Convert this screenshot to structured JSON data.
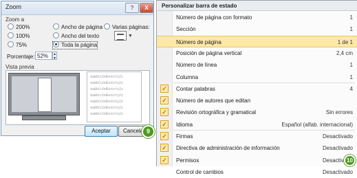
{
  "zoom_dialog": {
    "title": "Zoom",
    "help_icon": "?",
    "close_icon": "X",
    "group_label": "Zoom a",
    "options": {
      "p200": "200%",
      "p100": "100%",
      "p75": "75%",
      "page_width": "Ancho de página",
      "text_width": "Ancho del texto",
      "whole_page": "Toda la página",
      "many_pages": "Varias páginas:"
    },
    "percent_label": "Porcentaje:",
    "percent_value": "52%",
    "preview_label": "Vista previa",
    "sample_text": [
      "AaBbCcDdEeXxYyZz",
      "AaBbCcDdEeXxYyZz",
      "AaBbCcDdEeXxYyZz",
      "AaBbCcDdEeXxYyZz",
      "AaBbCcDdEeXxYyZz",
      "AaBbCcDdEeXxYyZz",
      "AaBbCcDdEeXxYyZz"
    ],
    "ok_label": "Aceptar",
    "cancel_label": "Cancelar",
    "badge": "9"
  },
  "status_menu": {
    "title": "Personalizar barra de estado",
    "badge": "10",
    "check_mark": "✓",
    "items": [
      {
        "label": "Número de página con formato",
        "value": "1",
        "checked": false
      },
      {
        "label": "Sección",
        "value": "1",
        "checked": false
      },
      {
        "label": "Número de página",
        "value": "1 de 1",
        "checked": false,
        "highlighted": true
      },
      {
        "label": "Posición de página vertical",
        "value": "2,4 cm",
        "checked": false
      },
      {
        "label": "Número de línea",
        "value": "1",
        "checked": false
      },
      {
        "label": "Columna",
        "value": "1",
        "checked": false
      },
      {
        "label": "Contar palabras",
        "value": "4",
        "checked": true
      },
      {
        "label": "Número de autores que editan",
        "value": "",
        "checked": true
      },
      {
        "label": "Revisión ortográfica y gramatical",
        "value": "Sin errores",
        "checked": true
      },
      {
        "label": "Idioma",
        "value": "Español (alfab. internacional)",
        "checked": true
      },
      {
        "label": "Firmas",
        "value": "Desactivado",
        "checked": true
      },
      {
        "label": "Directiva de administración de información",
        "value": "Desactivado",
        "checked": true
      },
      {
        "label": "Permisos",
        "value": "Desactivado",
        "checked": true
      },
      {
        "label": "Control de cambios",
        "value": "Desactivado",
        "checked": false
      }
    ]
  },
  "colors": {
    "highlight": "#fce9a8",
    "check_bg": "#fde9b0",
    "badge_green": "#4d9a1e"
  }
}
